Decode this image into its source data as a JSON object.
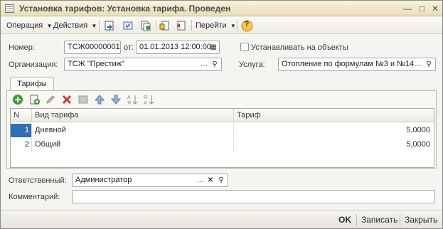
{
  "window": {
    "title": "Установка тарифов: Установка тарифа. Проведен"
  },
  "toolbar": {
    "operation_label": "Операция",
    "actions_label": "Действия",
    "goto_label": "Перейти",
    "help_label": "?"
  },
  "form": {
    "number_label": "Номер:",
    "number_value": "ТСЖ00000001",
    "from_label": "от:",
    "date_value": "01.01.2013 12:00:00",
    "apply_to_objects_label": "Устанавливать на объекты",
    "apply_to_objects_checked": false,
    "organization_label": "Организация:",
    "organization_value": "ТСЖ \"Престиж\"",
    "service_label": "Услуга:",
    "service_value": "Отопление по формулам №3 и №14"
  },
  "tabs": [
    {
      "label": "Тарифы",
      "active": true
    }
  ],
  "tariffs_table": {
    "columns": [
      "N",
      "Вид тарифа",
      "Тариф"
    ],
    "rows": [
      {
        "n": "1",
        "type": "Дневной",
        "tariff": "5,0000",
        "selected": true
      },
      {
        "n": "2",
        "type": "Общий",
        "tariff": "5,0000",
        "selected": false
      }
    ]
  },
  "bottom": {
    "responsible_label": "Ответственный:",
    "responsible_value": "Администратор",
    "comment_label": "Комментарий:",
    "comment_value": ""
  },
  "footer": {
    "ok_label": "OK",
    "save_label": "Записать",
    "close_label": "Закрыть"
  },
  "colors": {
    "title_bar": "#efe7c8",
    "accent_blue": "#2f6fb5",
    "add_green": "#3a9a3a",
    "delete_red": "#d23b2b",
    "help_orange": "#e89a1a"
  }
}
